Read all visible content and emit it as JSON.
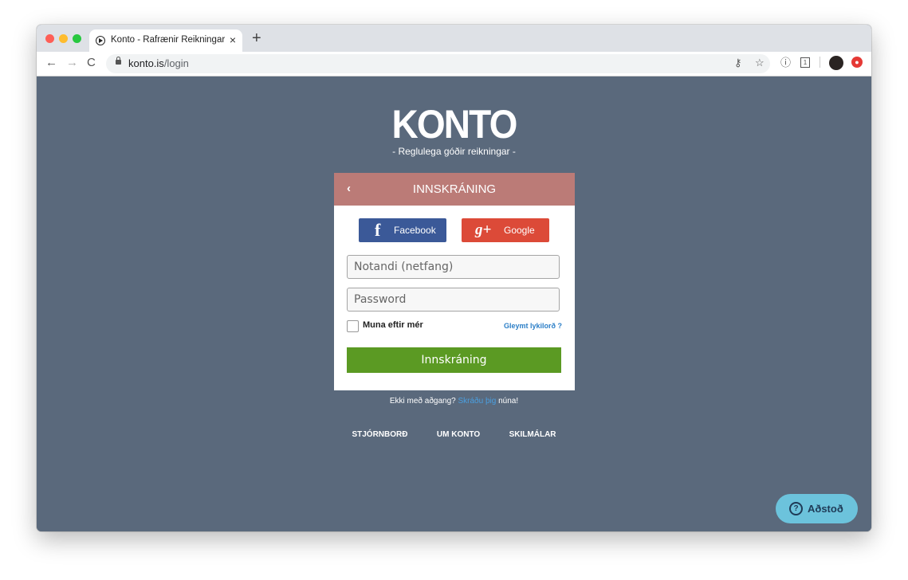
{
  "browser": {
    "tab_title": "Konto - Rafrænir Reikningar",
    "tab_close": "×",
    "new_tab": "+",
    "url_domain": "konto.is",
    "url_path": "/login",
    "nav": {
      "back": "←",
      "forward": "→",
      "reload": "C"
    },
    "icons": {
      "key": "key-icon",
      "star": "star-icon",
      "info": "info-icon",
      "extension": "extension-icon",
      "profile": "profile-avatar",
      "notification": "notification-icon"
    }
  },
  "brand": {
    "logo": "KONTO",
    "tagline": "- Reglulega góðir reikningar -"
  },
  "login": {
    "back": "‹",
    "title": "INNSKRÁNING",
    "facebook_label": "Facebook",
    "google_label": "Google",
    "username_placeholder": "Notandi (netfang)",
    "password_placeholder": "Password",
    "remember_label": "Muna eftir mér",
    "forgot_label": "Gleymt lykilorð ?",
    "submit_label": "Innskráning"
  },
  "signup": {
    "prefix": "Ekki með aðgang?",
    "link": "Skráðu þig",
    "suffix": "núna!"
  },
  "footer": {
    "links": [
      "STJÓRNBORÐ",
      "UM KONTO",
      "SKILMÁLAR"
    ]
  },
  "help": {
    "label": "Aðstoð",
    "icon": "?"
  },
  "colors": {
    "background": "#5a697c",
    "header": "#bb7b77",
    "facebook": "#3b5998",
    "google": "#dc4a38",
    "submit": "#5b9a23",
    "help": "#6cc3dc"
  }
}
